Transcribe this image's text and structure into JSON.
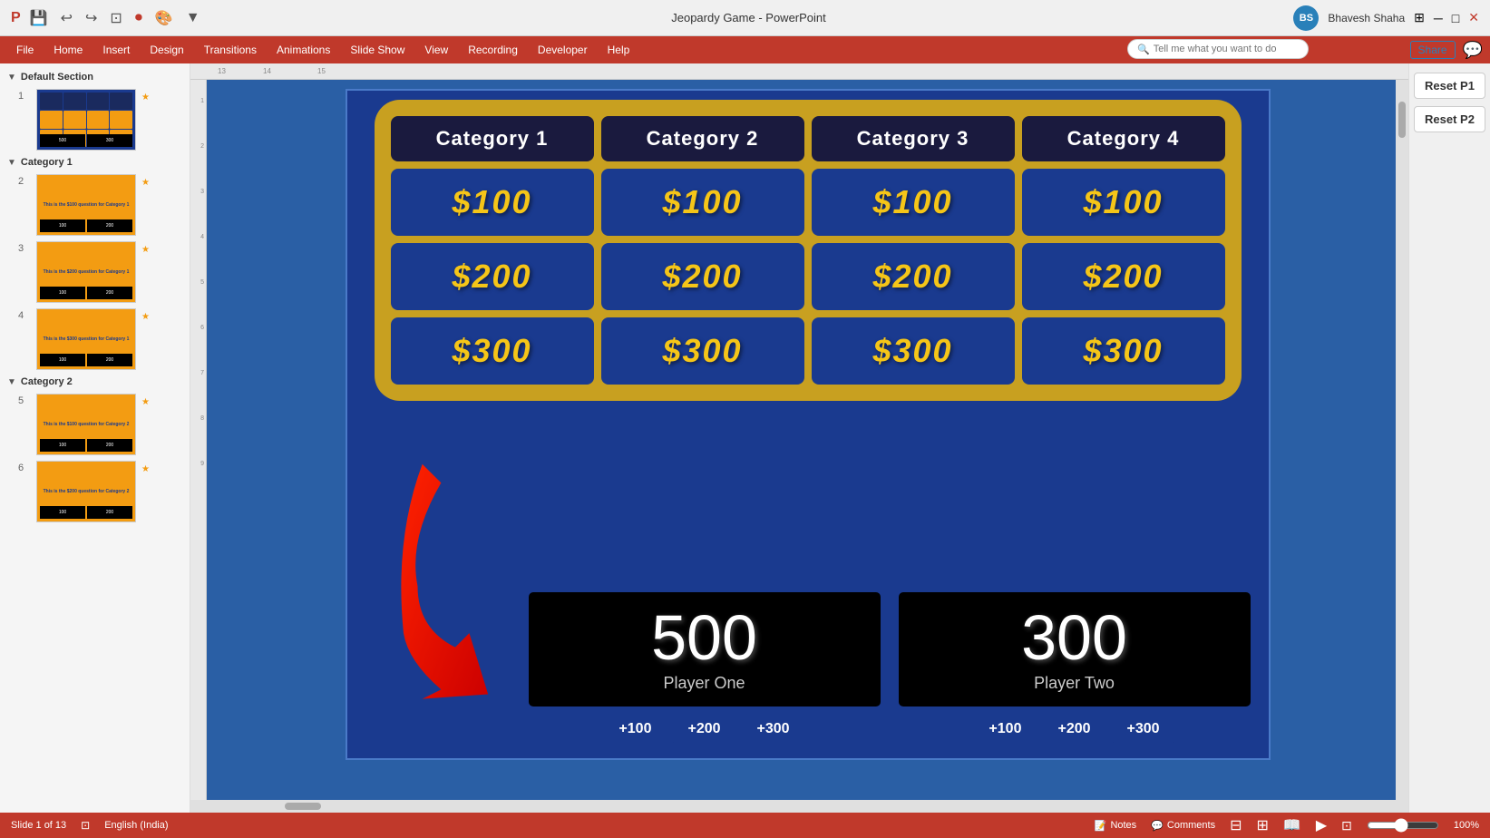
{
  "titlebar": {
    "title": "Jeopardy Game - PowerPoint",
    "user": "Bhavesh Shaha",
    "share_label": "Share",
    "comment_icon": "💬"
  },
  "ribbon": {
    "tabs": [
      "File",
      "Home",
      "Insert",
      "Design",
      "Transitions",
      "Animations",
      "Slide Show",
      "View",
      "Recording",
      "Developer",
      "Help"
    ]
  },
  "search": {
    "placeholder": "Tell me what you want to do"
  },
  "sidebar": {
    "sections": [
      {
        "name": "Default Section",
        "slides": [
          {
            "num": "1",
            "type": "main"
          }
        ]
      },
      {
        "name": "Category 1",
        "slides": [
          {
            "num": "2",
            "type": "question"
          },
          {
            "num": "3",
            "type": "question"
          },
          {
            "num": "4",
            "type": "question"
          }
        ]
      },
      {
        "name": "Category 2",
        "slides": [
          {
            "num": "5",
            "type": "question"
          },
          {
            "num": "6",
            "type": "question"
          }
        ]
      }
    ]
  },
  "slide": {
    "categories": [
      "Category 1",
      "Category 2",
      "Category 3",
      "Category 4"
    ],
    "values": [
      "$100",
      "$200",
      "$300"
    ],
    "scores": [
      {
        "number": "500",
        "label": "Player One"
      },
      {
        "number": "300",
        "label": "Player Two"
      }
    ],
    "score_buttons_p1": [
      "+100",
      "+200",
      "+300"
    ],
    "score_buttons_p2": [
      "+100",
      "+200",
      "+300"
    ]
  },
  "right_panel": {
    "reset_p1": "Reset P1",
    "reset_p2": "Reset P2"
  },
  "statusbar": {
    "slide_info": "Slide 1 of 13",
    "language": "English (India)",
    "notes_label": "Notes",
    "comments_label": "Comments",
    "zoom": "100%"
  }
}
